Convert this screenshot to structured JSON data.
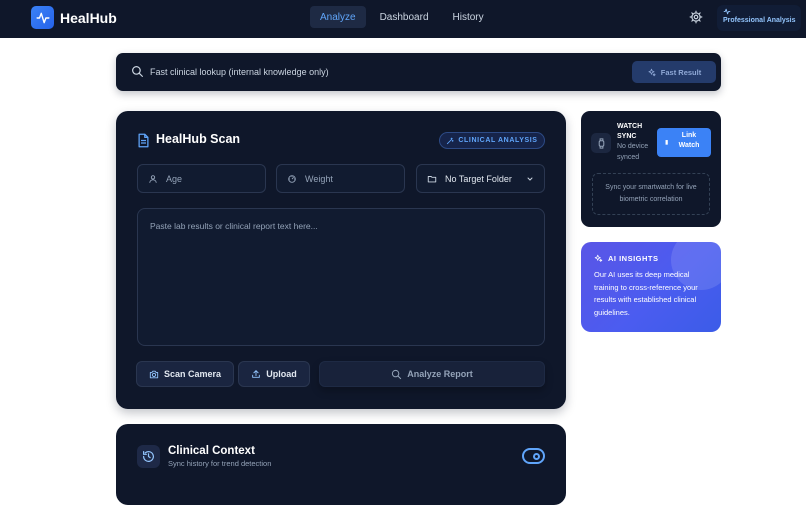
{
  "brand": {
    "name": "HealHub"
  },
  "nav": {
    "tabs": [
      {
        "label": "Analyze",
        "active": true
      },
      {
        "label": "Dashboard",
        "active": false
      },
      {
        "label": "History",
        "active": false
      }
    ]
  },
  "header": {
    "pro_label": "Professional Analysis",
    "settings_icon": "gear-icon"
  },
  "search": {
    "placeholder": "Fast clinical lookup (internal knowledge only)",
    "button_label": "Fast Result"
  },
  "scan": {
    "title": "HealHub Scan",
    "badge": "CLINICAL ANALYSIS",
    "age_placeholder": "Age",
    "weight_placeholder": "Weight",
    "folder_value": "No Target Folder",
    "report_placeholder": "Paste lab results or clinical report text here...",
    "camera_label": "Scan Camera",
    "upload_label": "Upload",
    "analyze_label": "Analyze Report"
  },
  "watch": {
    "title_line1": "WATCH",
    "title_line2": "SYNC",
    "status_line1": "No device",
    "status_line2": "synced",
    "link_line1": "Link",
    "link_line2": "Watch",
    "note": "Sync your smartwatch for live biometric correlation"
  },
  "insights": {
    "title": "AI INSIGHTS",
    "body": "Our AI uses its deep medical training to cross-reference your results with established clinical guidelines."
  },
  "context": {
    "title": "Clinical Context",
    "subtitle": "Sync history for trend detection",
    "toggle_on": true
  },
  "colors": {
    "accent": "#3b82f6",
    "panel": "#0f172a",
    "insight_gradient_start": "#5a55e6",
    "insight_gradient_end": "#3b5ce8"
  }
}
